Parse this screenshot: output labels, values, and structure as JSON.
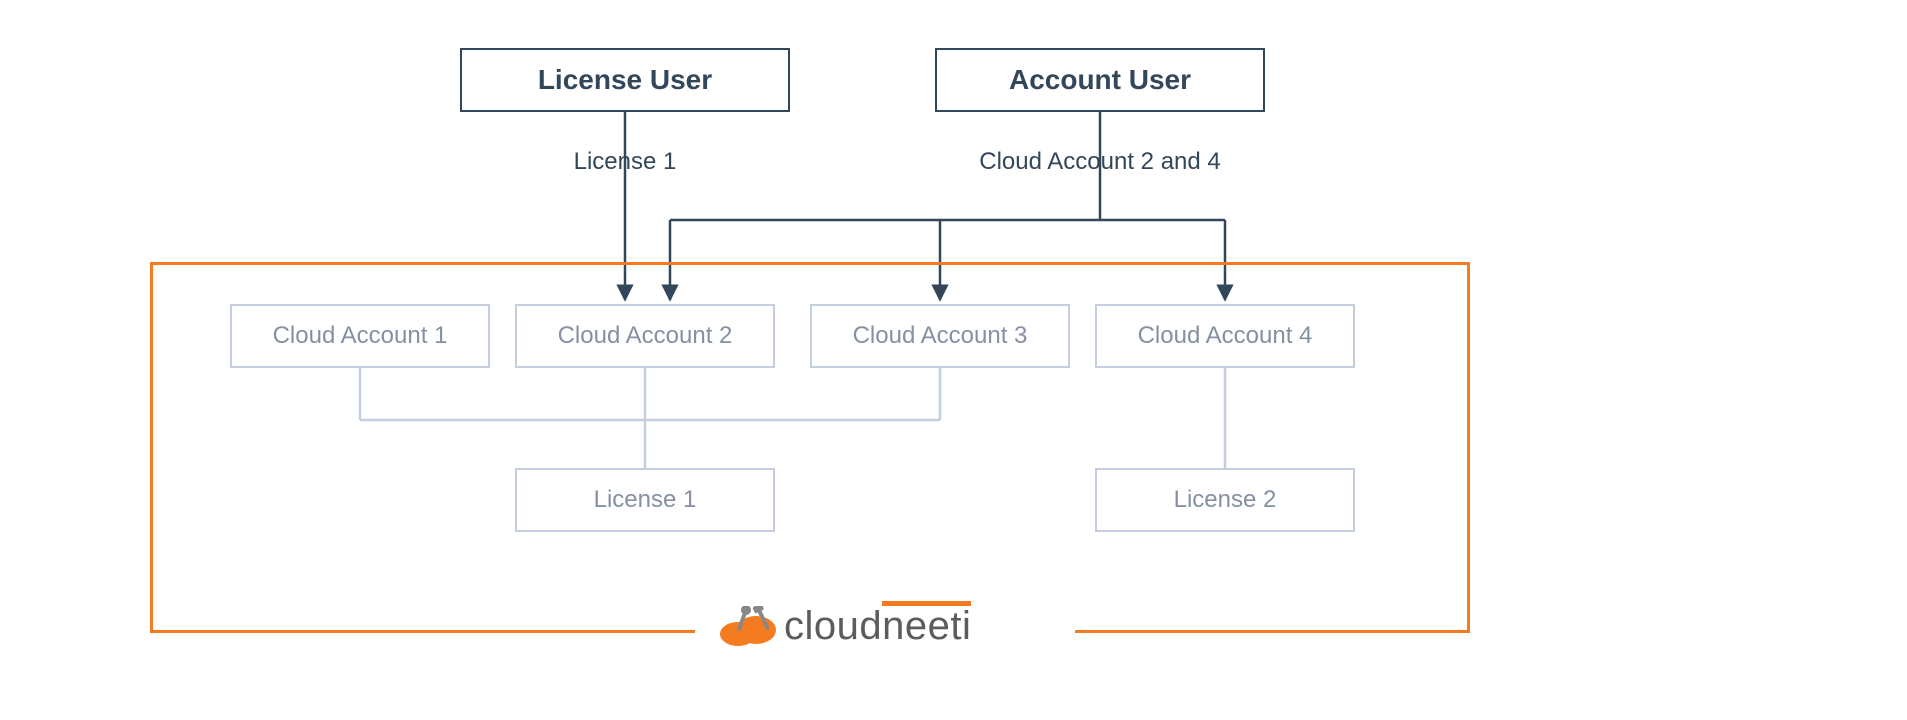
{
  "top_nodes": {
    "license_user": "License User",
    "account_user": "Account User"
  },
  "edge_labels": {
    "license_user_label": "License 1",
    "account_user_label": "Cloud Account 2 and 4"
  },
  "cloud_accounts": [
    "Cloud Account 1",
    "Cloud Account 2",
    "Cloud Account 3",
    "Cloud Account 4"
  ],
  "licenses": {
    "license1": "License 1",
    "license2": "License 2"
  },
  "logo": {
    "brand_main": "cloud",
    "brand_accent": "neeti"
  },
  "colors": {
    "dark": "#33475b",
    "faded_border": "#c4cede",
    "faded_text": "#8590a2",
    "accent": "#f47b20"
  }
}
